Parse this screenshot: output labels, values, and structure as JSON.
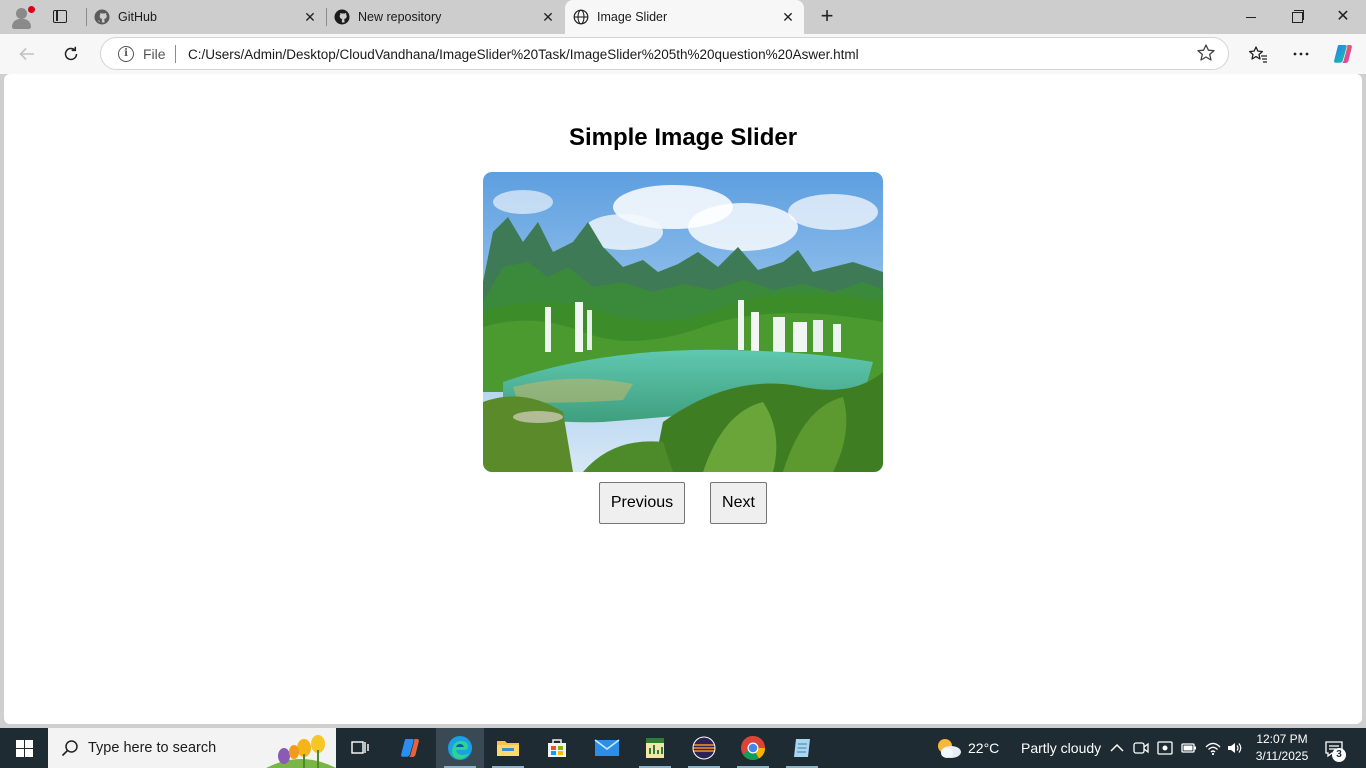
{
  "browser": {
    "tabs": [
      {
        "title": "GitHub",
        "favicon": "github-icon",
        "active": false
      },
      {
        "title": "New repository",
        "favicon": "github-icon",
        "active": false
      },
      {
        "title": "Image Slider",
        "favicon": "globe-icon",
        "active": true
      }
    ],
    "close_glyph": "✕",
    "new_tab_glyph": "+"
  },
  "toolbar": {
    "file_label": "File",
    "url": "C:/Users/Admin/Desktop/CloudVandhana/ImageSlider%20Task/ImageSlider%205th%20question%20Aswer.html",
    "icons": [
      "back-arrow-icon",
      "refresh-icon",
      "info-icon",
      "favorite-star-icon",
      "favorites-icon",
      "more-icon",
      "copilot-icon"
    ]
  },
  "page": {
    "title": "Simple Image Slider",
    "slide_image": "waterfall-landscape-image",
    "buttons": {
      "previous": "Previous",
      "next": "Next"
    }
  },
  "taskbar": {
    "search_placeholder": "Type here to search",
    "apps": [
      "task-view-icon",
      "copilot-icon",
      "edge-icon",
      "file-explorer-icon",
      "store-icon",
      "mail-icon",
      "spreadsheet-icon",
      "eclipse-icon",
      "chrome-icon",
      "notepad-icon"
    ],
    "weather": {
      "temp": "22°C",
      "desc": "Partly cloudy"
    },
    "clock": {
      "time": "12:07 PM",
      "date": "3/11/2025"
    },
    "notification_count": "3"
  },
  "colors": {
    "tabstrip": "#cdcdcd",
    "toolbar": "#f7f7f7",
    "taskbar": "#1f2b33",
    "button_face": "#efefef"
  }
}
